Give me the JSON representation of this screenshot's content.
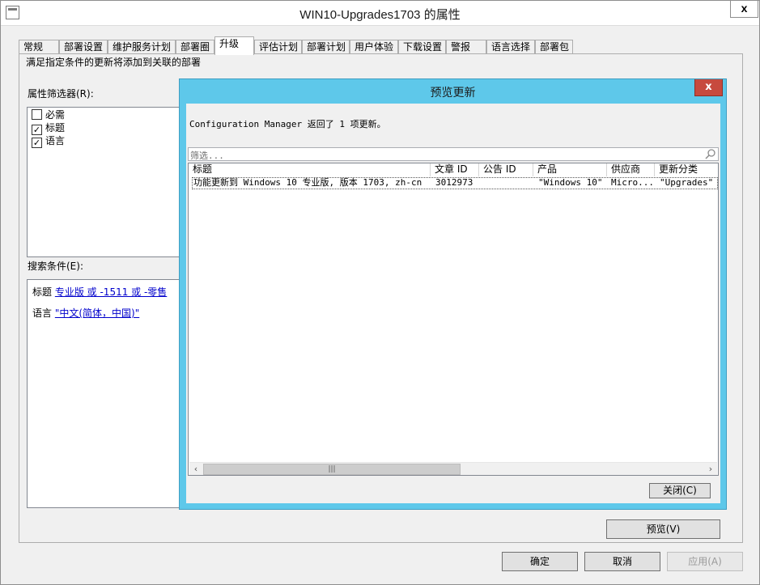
{
  "window": {
    "title": "WIN10-Upgrades1703 的属性",
    "close_glyph": "x"
  },
  "tabs": [
    {
      "label": "常规"
    },
    {
      "label": "部署设置"
    },
    {
      "label": "维护服务计划"
    },
    {
      "label": "部署圈"
    },
    {
      "label": "升级",
      "active": true
    },
    {
      "label": "评估计划"
    },
    {
      "label": "部署计划"
    },
    {
      "label": "用户体验"
    },
    {
      "label": "下载设置"
    },
    {
      "label": "警报"
    },
    {
      "label": "语言选择"
    },
    {
      "label": "部署包"
    }
  ],
  "panel": {
    "description": "满足指定条件的更新将添加到关联的部署",
    "property_filter_label": "属性筛选器(R):",
    "properties": [
      {
        "label": "必需",
        "checked": false
      },
      {
        "label": "标题",
        "checked": true
      },
      {
        "label": "语言",
        "checked": true
      }
    ],
    "search_criteria_label": "搜索条件(E):",
    "criteria": [
      {
        "name": "标题",
        "value": "专业版 或 -1511 或 -零售"
      },
      {
        "name": "语言",
        "value": "\"中文(简体，中国)\""
      }
    ],
    "preview_button": "预览(V)"
  },
  "footer": {
    "ok": "确定",
    "cancel": "取消",
    "apply": "应用(A)"
  },
  "dialog": {
    "title": "预览更新",
    "close_glyph": "x",
    "message": "Configuration Manager 返回了 1 项更新。",
    "filter_placeholder": "筛选...",
    "columns": [
      "标题",
      "文章 ID",
      "公告 ID",
      "产品",
      "供应商",
      "更新分类"
    ],
    "rows": [
      {
        "title": "功能更新到 Windows 10 专业版, 版本 1703, zh-cn",
        "article_id": "3012973",
        "bulletin_id": "",
        "product": "\"Windows 10\"",
        "vendor": "Micro...",
        "classification": "\"Upgrades\""
      }
    ],
    "close_button": "关闭(C)",
    "accent_color": "#5ec8ea",
    "close_color": "#c74a3e"
  }
}
